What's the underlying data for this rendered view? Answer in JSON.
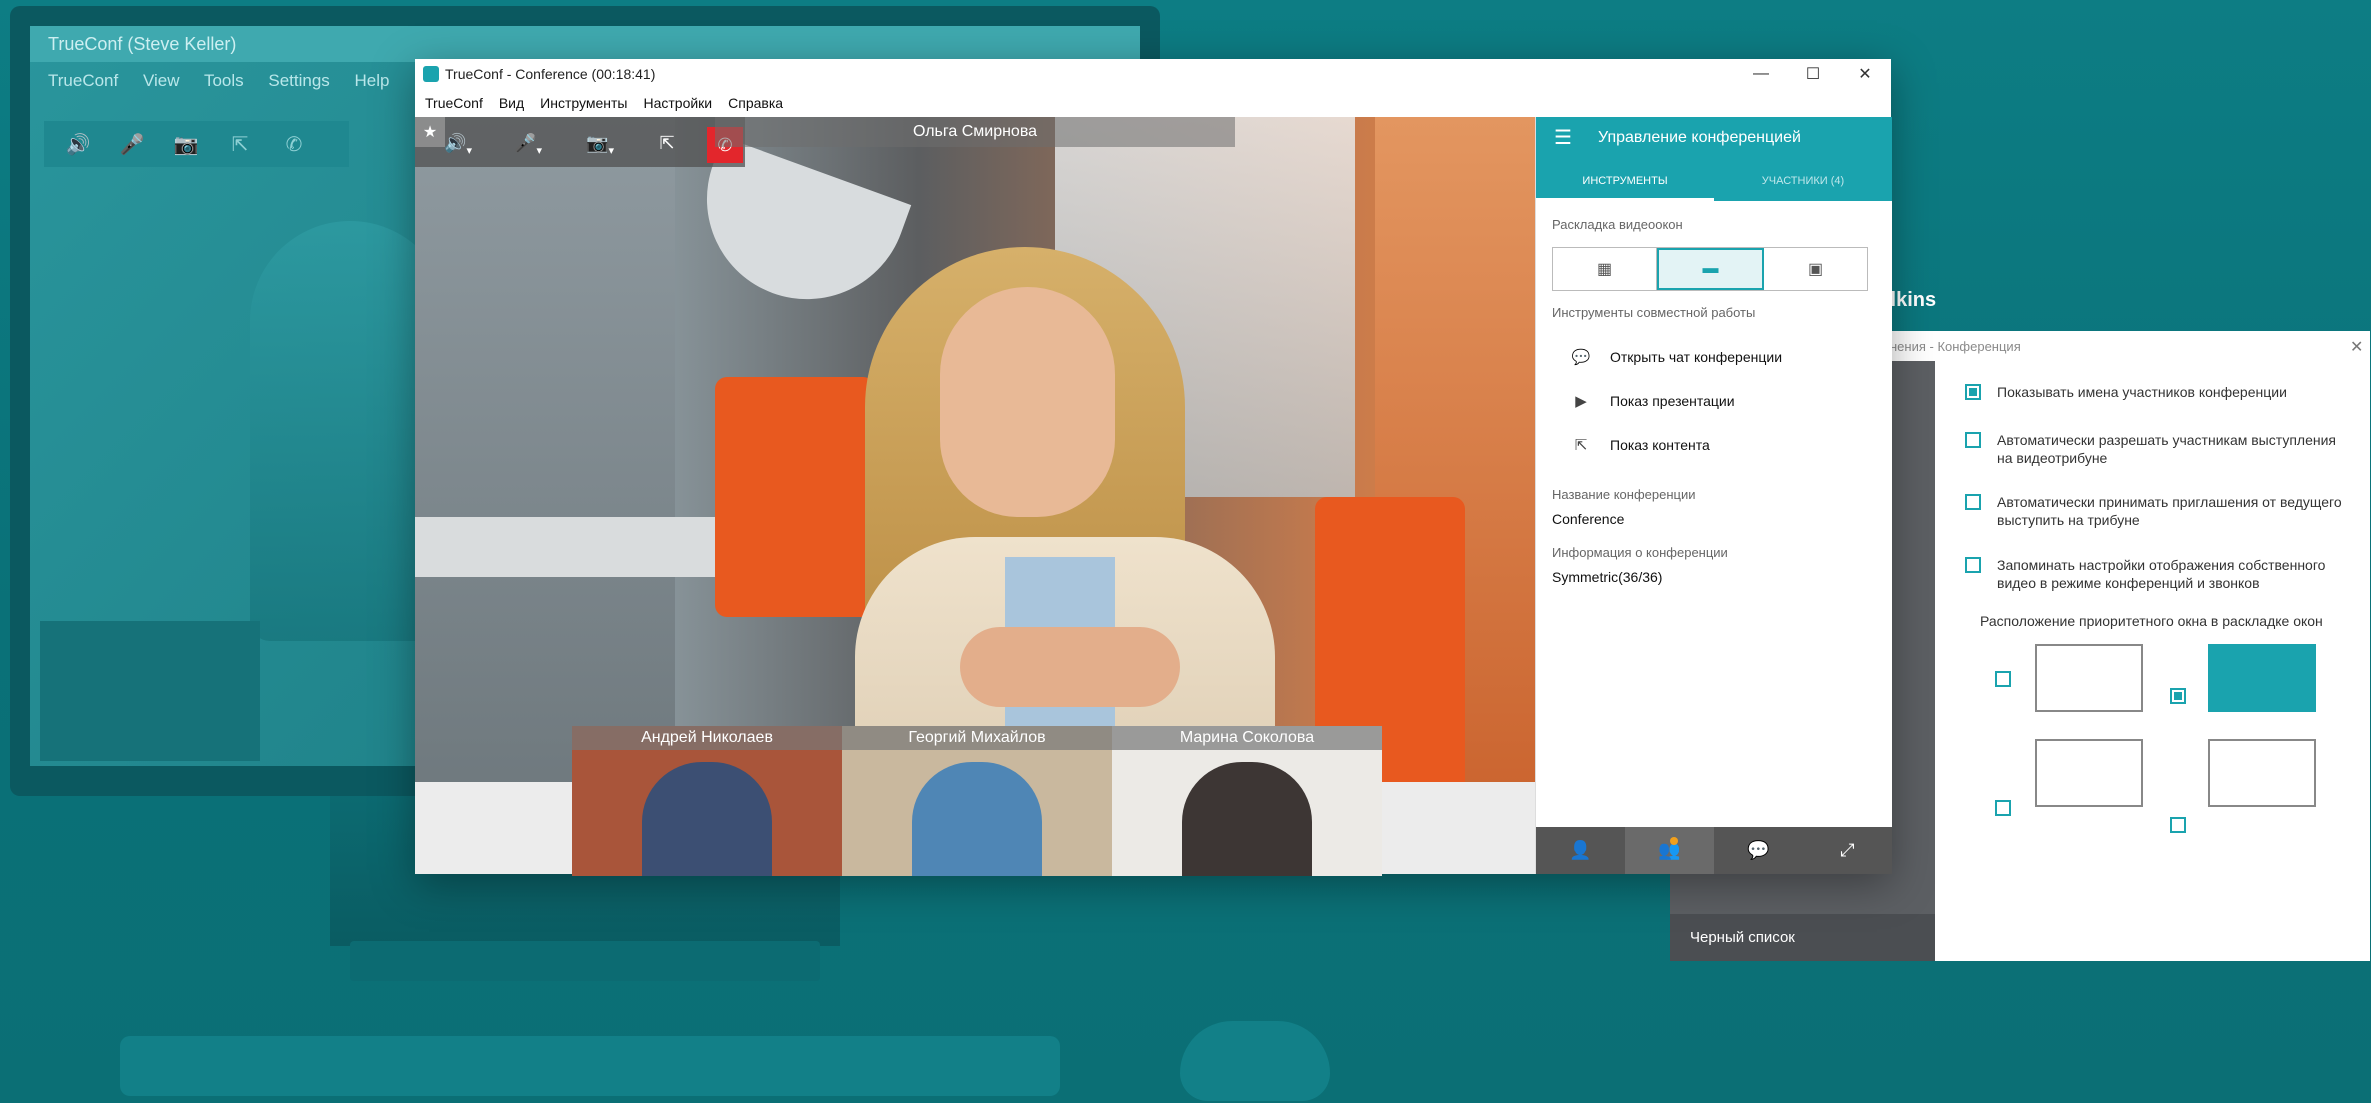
{
  "background_app": {
    "title": "TrueConf (Steve Keller)",
    "menu": [
      "TrueConf",
      "View",
      "Tools",
      "Settings",
      "Help"
    ],
    "toolbar_icons": [
      "speaker-icon",
      "mic-icon",
      "camera-icon",
      "share-icon",
      "hangup-icon"
    ],
    "toolbar_glyphs": [
      "🔊",
      "🎤",
      "📷",
      "⇱",
      "✆"
    ]
  },
  "window": {
    "app_name": "TrueConf - Conference (00:18:41)",
    "controls": {
      "minimize": "—",
      "maximize": "☐",
      "close": "✕"
    },
    "menu": [
      "TrueConf",
      "Вид",
      "Инструменты",
      "Настройки",
      "Справка"
    ]
  },
  "video_toolbar": {
    "star": "★",
    "speaker": "🔊",
    "mic": "🎤",
    "camera": "📷",
    "share": "⇱",
    "hangup": "✆",
    "dropdown": "▾"
  },
  "speaker_name": "Ольга Смирнова",
  "thumbnails": [
    {
      "name": "Андрей Николаев",
      "bg": "#a9553a",
      "person": "#3c4f73"
    },
    {
      "name": "Георгий Михайлов",
      "bg": "#c9b89e",
      "person": "#4f86b5"
    },
    {
      "name": "Марина Соколова",
      "bg": "#eceae6",
      "person": "#3d3634"
    }
  ],
  "panel": {
    "title": "Управление конференцией",
    "tabs": {
      "tools": "ИНСТРУМЕНТЫ",
      "participants": "УЧАСТНИКИ (4)"
    },
    "layout_label": "Раскладка видеоокон",
    "layout_buttons": [
      "▦",
      "▬",
      "▣"
    ],
    "collab_label": "Инструменты совместной работы",
    "tools": [
      {
        "icon": "chat-icon",
        "glyph": "💬",
        "label": "Открыть чат конференции"
      },
      {
        "icon": "presentation-icon",
        "glyph": "▶",
        "label": "Показ презентации"
      },
      {
        "icon": "content-share-icon",
        "glyph": "⇱",
        "label": "Показ контента"
      }
    ],
    "conf_name_label": "Название конференции",
    "conf_name": "Conference",
    "conf_info_label": "Информация о конференции",
    "conf_info": "Symmetric(36/36)",
    "bottom_icons": [
      "👤",
      "👥",
      "💬",
      "⤢"
    ]
  },
  "settings": {
    "side_title": "llkins",
    "header": "нения - Конференция",
    "close": "✕",
    "options": [
      {
        "label": "Показывать имена участников конференции",
        "checked": true
      },
      {
        "label": "Автоматически разрешать участникам выступления на видеотрибуне",
        "checked": false
      },
      {
        "label": "Автоматически принимать приглашения от ведущего выступить на трибуне",
        "checked": false
      },
      {
        "label": "Запоминать настройки отображения собственного видео в режиме конференций и звонков",
        "checked": false
      }
    ],
    "priority_label": "Расположение приоритетного окна в раскладке окон",
    "blacklist": "Черный список"
  },
  "colors": {
    "accent": "#1aa3ae",
    "hangup": "#e3262c",
    "background": "#0d7d84"
  }
}
